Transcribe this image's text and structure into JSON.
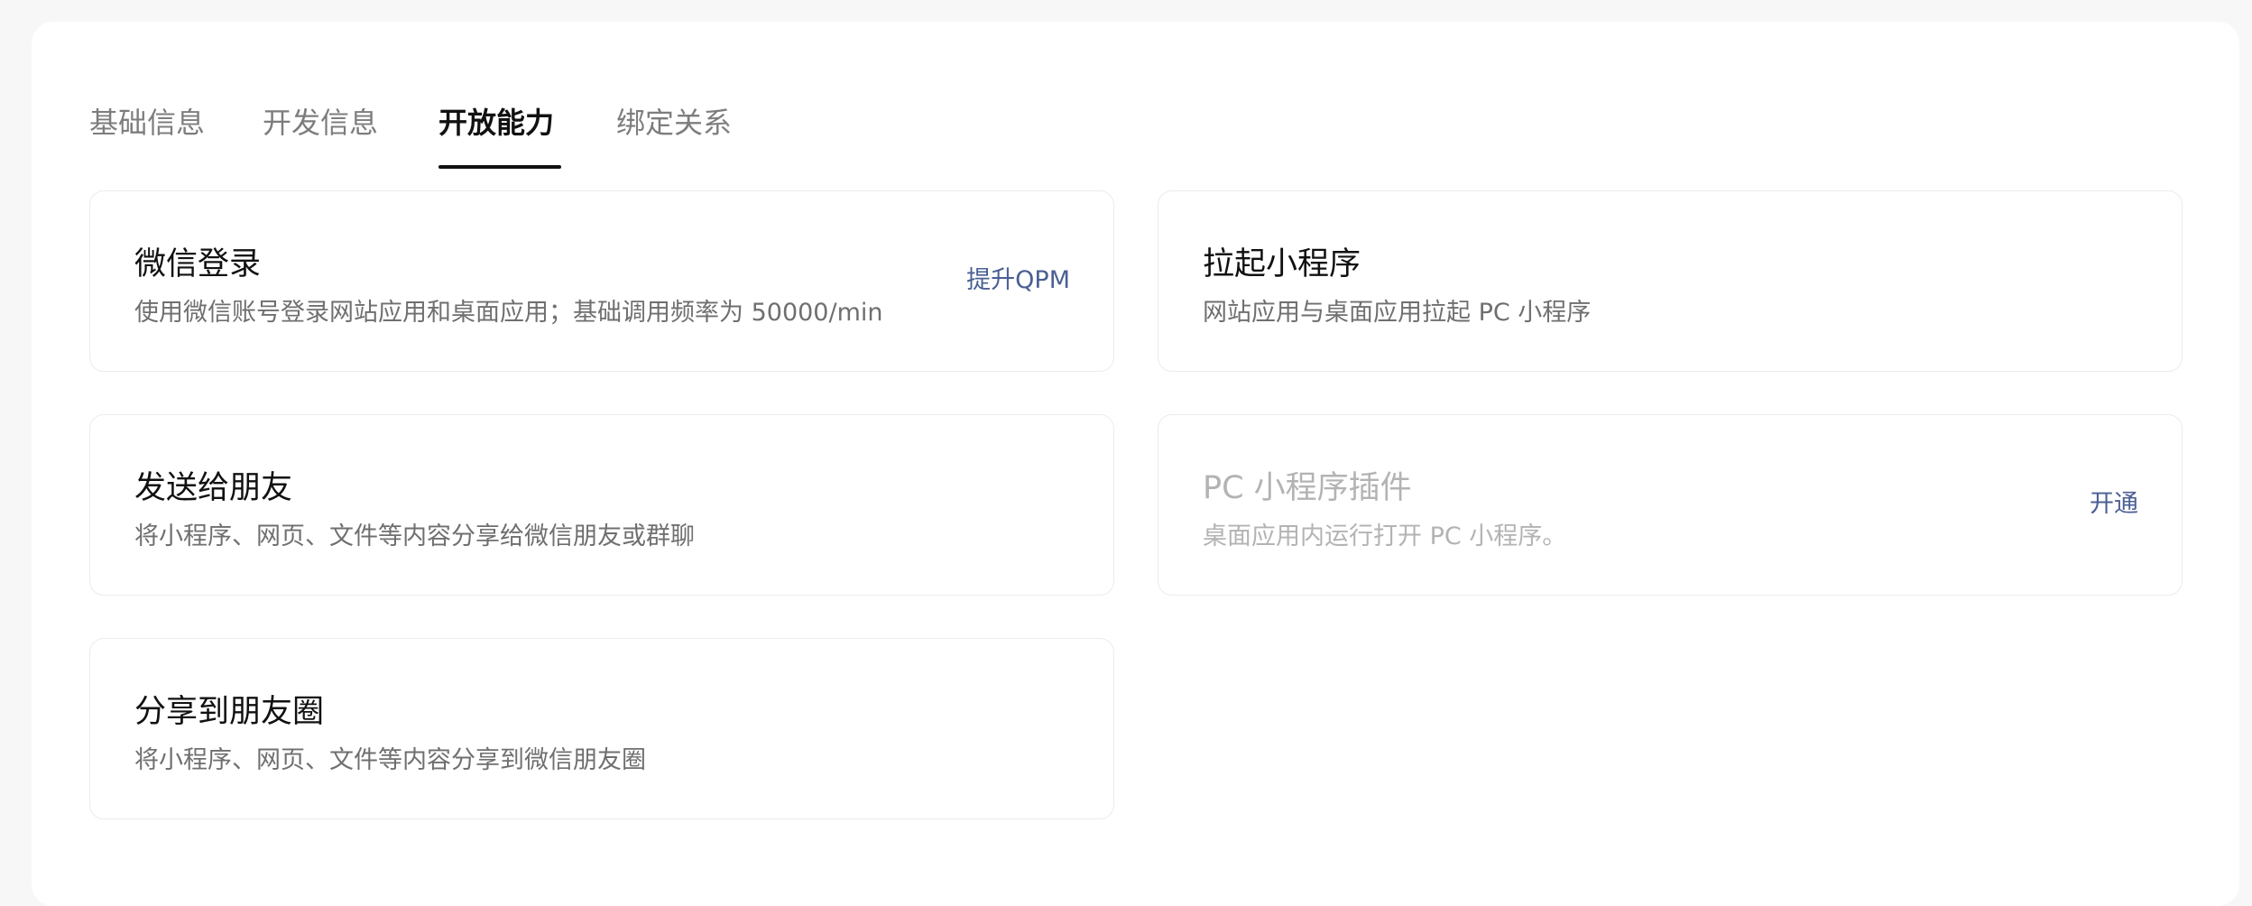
{
  "tabs": [
    {
      "label": "基础信息",
      "active": false
    },
    {
      "label": "开发信息",
      "active": false
    },
    {
      "label": "开放能力",
      "active": true
    },
    {
      "label": "绑定关系",
      "active": false
    }
  ],
  "cards": [
    {
      "title": "微信登录",
      "desc": "使用微信账号登录网站应用和桌面应用；基础调用频率为 50000/min",
      "action": "提升QPM",
      "disabled": false
    },
    {
      "title": "拉起小程序",
      "desc": "网站应用与桌面应用拉起 PC 小程序",
      "action": "",
      "disabled": false
    },
    {
      "title": "发送给朋友",
      "desc": "将小程序、网页、文件等内容分享给微信朋友或群聊",
      "action": "",
      "disabled": false
    },
    {
      "title": "PC 小程序插件",
      "desc": "桌面应用内运行打开 PC 小程序。",
      "action": "开通",
      "disabled": true
    },
    {
      "title": "分享到朋友圈",
      "desc": "将小程序、网页、文件等内容分享到微信朋友圈",
      "action": "",
      "disabled": false
    }
  ],
  "colors": {
    "accent": "#4a5f93",
    "text_primary": "#111111",
    "text_secondary": "#6f6f6f",
    "text_disabled": "#b3b3b3",
    "page_bg": "#f7f7f7"
  }
}
